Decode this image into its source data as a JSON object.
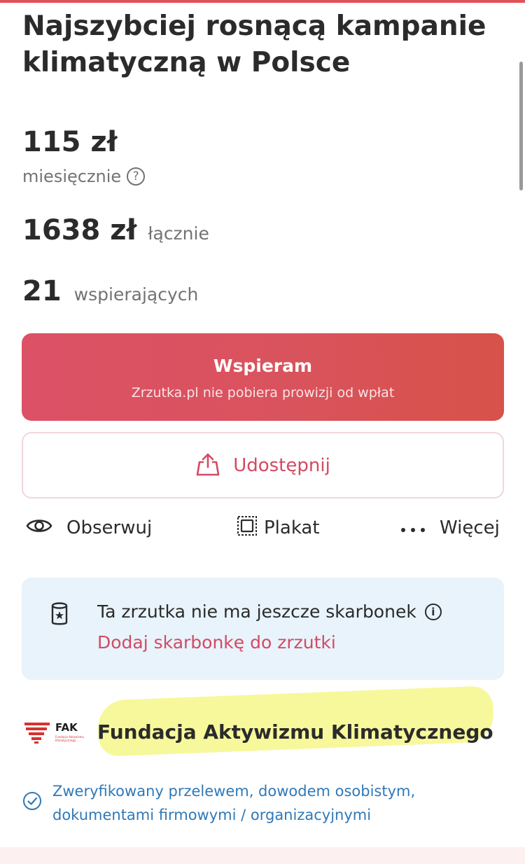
{
  "campaign": {
    "title": "Najszybciej rosnącą kampanie klimatyczną w Polsce"
  },
  "stats": {
    "monthly_amount": "115 zł",
    "monthly_label": "miesięcznie",
    "total_amount": "1638 zł",
    "total_label": "łącznie",
    "supporters_count": "21",
    "supporters_label": "wspierających"
  },
  "support_button": {
    "label": "Wspieram",
    "sublabel": "Zrzutka.pl nie pobiera prowizji od wpłat"
  },
  "share_button": {
    "label": "Udostępnij",
    "icon": "share-icon"
  },
  "actions": [
    {
      "label": "Obserwuj",
      "icon": "eye-icon"
    },
    {
      "label": "Plakat",
      "icon": "poster-icon"
    },
    {
      "label": "Więcej",
      "icon": "more-dots-icon"
    }
  ],
  "piggy_box": {
    "message": "Ta zrzutka nie ma jeszcze skarbonek",
    "link": "Dodaj skarbonkę do zrzutki",
    "icon": "piggy-bank-icon"
  },
  "organizer": {
    "logo_text": "FAK",
    "logo_subtext": "Fundacja Aktywizmu Klimatycznego",
    "name": "Fundacja Aktywizmu Klimatycznego"
  },
  "verification": {
    "text": "Zweryfikowany przelewem, dowodem osobistym, dokumentami firmowymi / organizacyjnymi"
  },
  "colors": {
    "accent": "#d24a63",
    "support_button": "#d9535d",
    "info_box": "#e8f3fb",
    "verified": "#2f79b8",
    "highlight": "#f4f57a"
  }
}
